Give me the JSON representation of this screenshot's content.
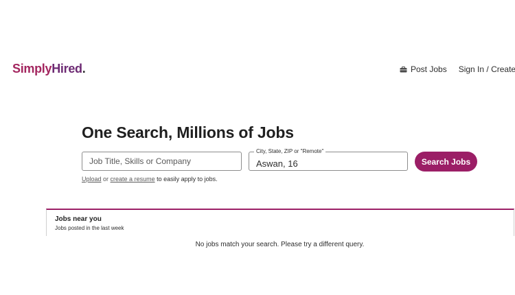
{
  "header": {
    "logo": {
      "part1": "Simply",
      "part2": "Hired",
      "dot": "."
    },
    "nav": {
      "post_jobs_icon": "briefcase-icon",
      "post_jobs_label": "Post Jobs",
      "signin_label": "Sign In / Create Acco"
    }
  },
  "hero": {
    "title": "One Search, Millions of Jobs",
    "what_placeholder": "Job Title, Skills or Company",
    "where_label": "City, State, ZIP or \"Remote\"",
    "where_value": "Aswan, 16",
    "search_button": "Search Jobs",
    "helper": {
      "upload_link": "Upload",
      "or_text": " or ",
      "create_link": "create a resume",
      "suffix": " to easily apply to jobs."
    }
  },
  "jobs_near_you": {
    "title": "Jobs near you",
    "subtitle": "Jobs posted in the last week",
    "empty_message": "No jobs match your search. Please try a different query."
  },
  "colors": {
    "brand_magenta": "#9b1e66",
    "logo_pink": "#a3265f",
    "logo_purple": "#6d2a73"
  }
}
